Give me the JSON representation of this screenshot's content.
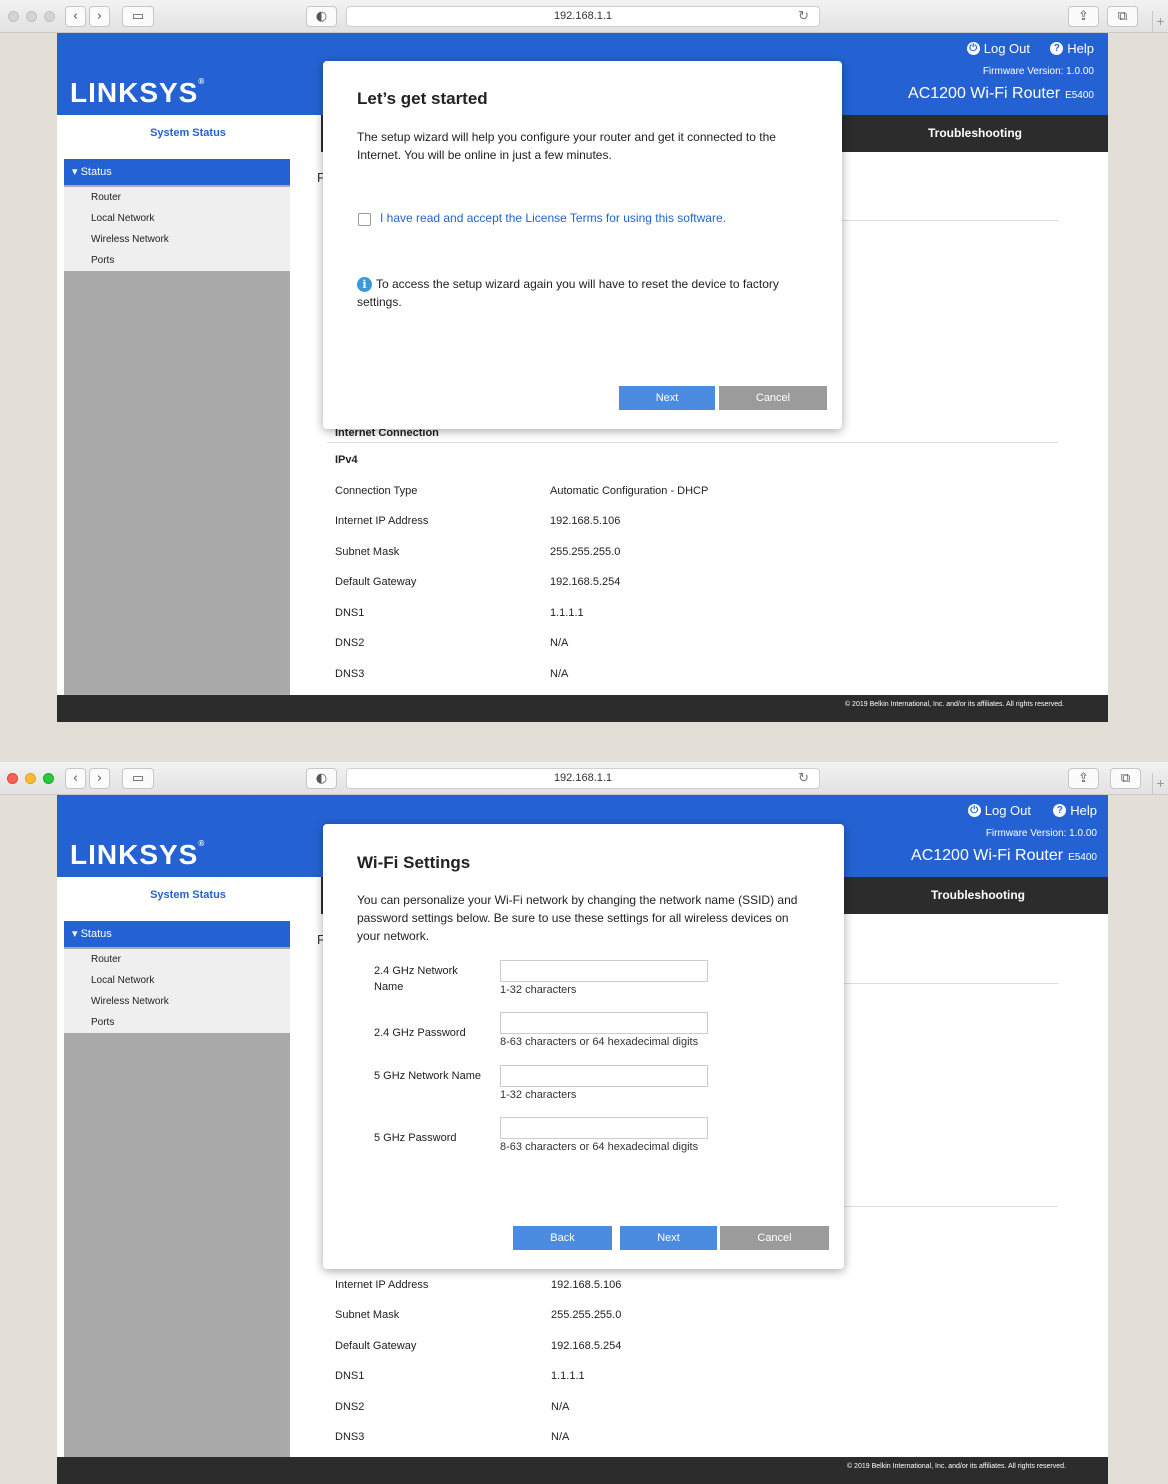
{
  "browser": {
    "url": "192.168.1.1",
    "new_tab": "+"
  },
  "router": {
    "logo": "LINKSYS",
    "logout": "Log Out",
    "help": "Help",
    "firmware": "Firmware Version: 1.0.00",
    "model": "AC1200 Wi-Fi Router",
    "model_code": "E5400",
    "system_status": "System Status",
    "troubleshooting": "Troubleshooting",
    "sidebar_status": "Status",
    "sidebar_items": [
      "Router",
      "Local Network",
      "Wireless Network",
      "Ports"
    ],
    "hidden_heading_letter": "F",
    "footer": "© 2019 Belkin International, Inc. and/or its affiliates. All rights reserved.",
    "colors": {
      "brand_blue": "#2462d4",
      "dark_bar": "#2c2c2c",
      "sidebar_grey": "#a9a9a9"
    }
  },
  "internet": {
    "section_title": "Internet Connection",
    "ipv4": "IPv4",
    "rows": [
      {
        "label": "Connection Type",
        "value": "Automatic Configuration - DHCP"
      },
      {
        "label": "Internet IP Address",
        "value": "192.168.5.106"
      },
      {
        "label": "Subnet Mask",
        "value": "255.255.255.0"
      },
      {
        "label": "Default Gateway",
        "value": "192.168.5.254"
      },
      {
        "label": "DNS1",
        "value": "1.1.1.1"
      },
      {
        "label": "DNS2",
        "value": "N/A"
      },
      {
        "label": "DNS3",
        "value": "N/A"
      }
    ]
  },
  "wizard1": {
    "title": "Let’s get started",
    "intro": "The setup wizard will help you configure your router and get it connected to the Internet. You will be online in just a few minutes.",
    "license_label": "I have read and accept the License Terms for using this software.",
    "info": "To access the setup wizard again you will have to reset the device to factory settings.",
    "next": "Next",
    "cancel": "Cancel"
  },
  "wizard2": {
    "title": "Wi-Fi Settings",
    "intro": "You can personalize your Wi-Fi network by changing the network name (SSID) and password settings below. Be sure to use these settings for all wireless devices on your network.",
    "fields": [
      {
        "label": "2.4 GHz Network Name",
        "value": "",
        "hint": "1-32 characters"
      },
      {
        "label": "2.4 GHz Password",
        "value": "",
        "hint": "8-63 characters or 64 hexadecimal digits"
      },
      {
        "label": "5 GHz Network Name",
        "value": "",
        "hint": "1-32 characters"
      },
      {
        "label": "5 GHz Password",
        "value": "",
        "hint": "8-63 characters or 64 hexadecimal digits"
      }
    ],
    "back": "Back",
    "next": "Next",
    "cancel": "Cancel"
  }
}
